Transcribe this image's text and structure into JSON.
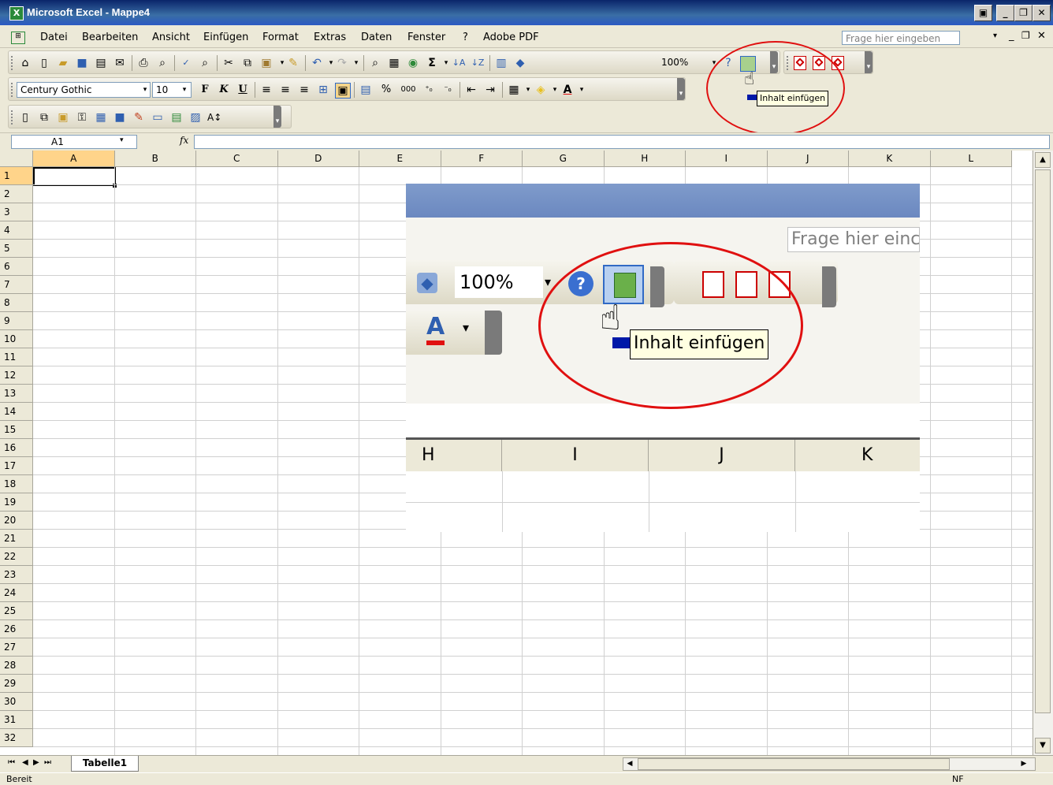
{
  "window": {
    "title": "Microsoft Excel - Mappe4",
    "app_icon": "excel-icon"
  },
  "menu": {
    "items": [
      "Datei",
      "Bearbeiten",
      "Ansicht",
      "Einfügen",
      "Format",
      "Extras",
      "Daten",
      "Fenster",
      "?",
      "Adobe PDF"
    ],
    "help_placeholder": "Frage hier eingeben"
  },
  "standard_toolbar": {
    "zoom": "100%"
  },
  "formatting_toolbar": {
    "font": "Century Gothic",
    "size": "10",
    "bold": "F",
    "italic": "K",
    "underline": "U",
    "percent": "%",
    "thousands": "000"
  },
  "formula_bar": {
    "name_box": "A1",
    "fx": "fx",
    "value": ""
  },
  "tooltip": {
    "text": "Inhalt einfügen"
  },
  "grid": {
    "columns": [
      "A",
      "B",
      "C",
      "D",
      "E",
      "F",
      "G",
      "H",
      "I",
      "J",
      "K",
      "L"
    ],
    "rows": [
      "1",
      "2",
      "3",
      "4",
      "5",
      "6",
      "7",
      "8",
      "9",
      "10",
      "11",
      "12",
      "13",
      "14",
      "15",
      "16",
      "17",
      "18",
      "19",
      "20",
      "21",
      "22",
      "23",
      "24",
      "25",
      "26",
      "27",
      "28",
      "29",
      "30",
      "31",
      "32"
    ],
    "active_cell": "A1"
  },
  "inset": {
    "help_text": "Frage hier einc",
    "zoom": "100%",
    "tooltip_text": "Inhalt einfügen",
    "columns": [
      "H",
      "I",
      "J",
      "K"
    ]
  },
  "sheets": {
    "tabs": [
      "Tabelle1"
    ]
  },
  "status": {
    "left": "Bereit",
    "right": "NF"
  },
  "colors": {
    "highlight_ellipse": "#e01010",
    "titlebar": "#0a246a"
  }
}
